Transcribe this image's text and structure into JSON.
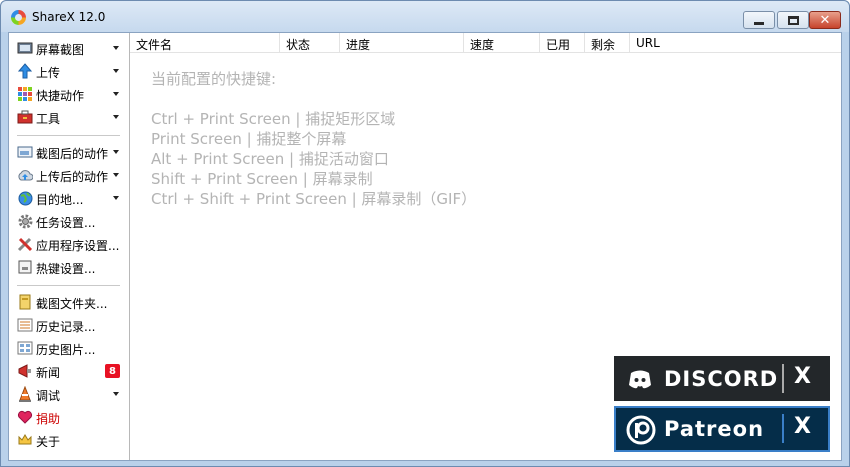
{
  "window": {
    "title": "ShareX 12.0"
  },
  "sidebar": {
    "items": [
      {
        "label": "屏幕截图",
        "icon": "screenshot-icon",
        "arrow": true
      },
      {
        "label": "上传",
        "icon": "upload-arrow-icon",
        "arrow": true
      },
      {
        "label": "快捷动作",
        "icon": "workflow-grid-icon",
        "arrow": true
      },
      {
        "label": "工具",
        "icon": "toolbox-icon",
        "arrow": true
      },
      {
        "label": "截图后的动作",
        "icon": "after-capture-icon",
        "arrow": true
      },
      {
        "label": "上传后的动作",
        "icon": "cloud-upload-icon",
        "arrow": true
      },
      {
        "label": "目的地...",
        "icon": "globe-icon",
        "arrow": true
      },
      {
        "label": "任务设置...",
        "icon": "gear-icon",
        "arrow": false
      },
      {
        "label": "应用程序设置...",
        "icon": "wrench-screwdriver-icon",
        "arrow": false
      },
      {
        "label": "热键设置...",
        "icon": "keyboard-icon",
        "arrow": false
      },
      {
        "label": "截图文件夹...",
        "icon": "folder-icon",
        "arrow": false
      },
      {
        "label": "历史记录...",
        "icon": "history-list-icon",
        "arrow": false
      },
      {
        "label": "历史图片...",
        "icon": "image-history-icon",
        "arrow": false
      },
      {
        "label": "新闻",
        "icon": "megaphone-icon",
        "arrow": false,
        "badge": "8"
      },
      {
        "label": "调试",
        "icon": "traffic-cone-icon",
        "arrow": true
      },
      {
        "label": "捐助",
        "icon": "heart-icon",
        "arrow": false
      },
      {
        "label": "关于",
        "icon": "crown-icon",
        "arrow": false
      }
    ]
  },
  "list": {
    "columns": [
      "文件名",
      "状态",
      "进度",
      "速度",
      "已用",
      "剩余",
      "URL"
    ]
  },
  "hotkeys": {
    "title": "当前配置的快捷键:",
    "lines": [
      "Ctrl + Print Screen  |  捕捉矩形区域",
      "Print Screen  |  捕捉整个屏幕",
      "Alt + Print Screen  |  捕捉活动窗口",
      "Shift + Print Screen  |  屏幕录制",
      "Ctrl + Shift + Print Screen  |  屏幕录制（GIF）"
    ]
  },
  "promos": {
    "discord": {
      "label": "DISCORD",
      "close": "X"
    },
    "patreon": {
      "label": "Patreon",
      "close": "X"
    }
  },
  "colors": {
    "titlebar": "#c6d9ee",
    "badge": "#e81123",
    "hotkey_text": "#b4b4b4",
    "discord_bg": "#23272a",
    "patreon_bg": "#052d49"
  }
}
